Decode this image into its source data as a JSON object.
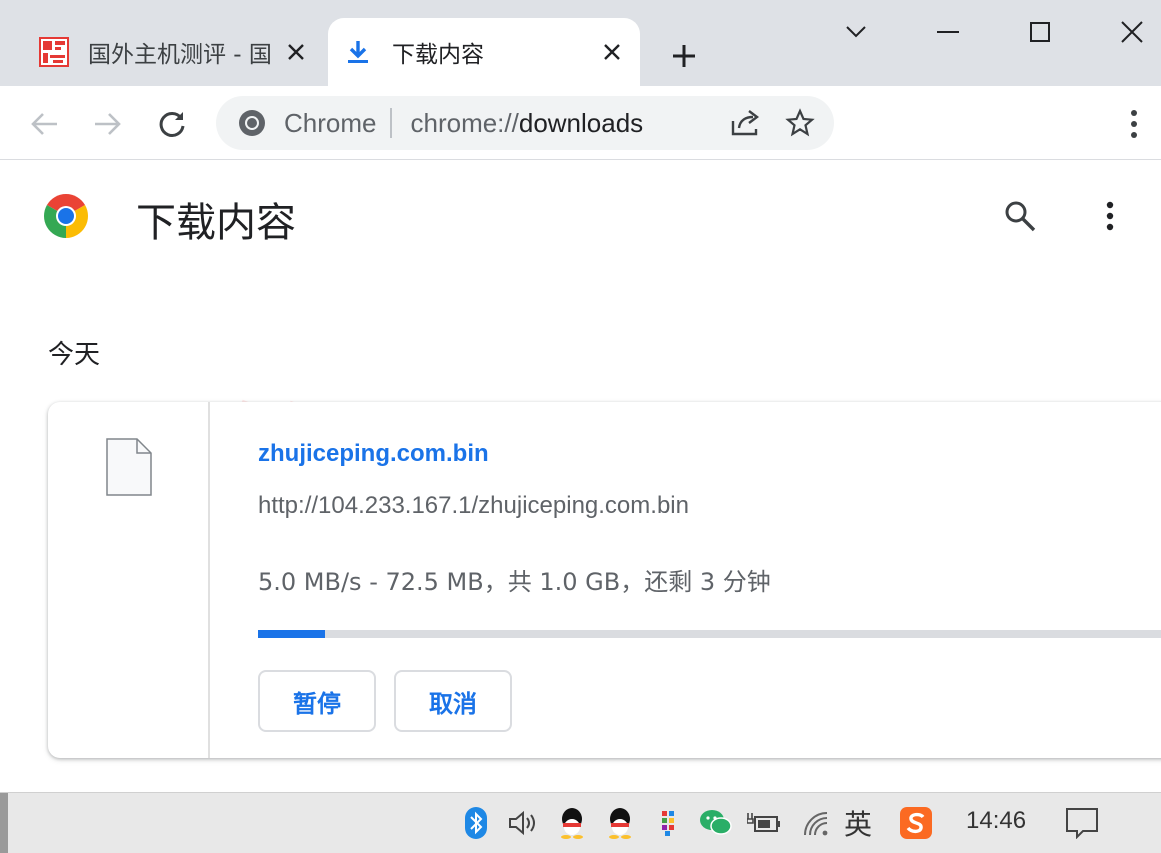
{
  "tabs": [
    {
      "title": "国外主机测评 - 国",
      "active": false,
      "favicon": "site-logo-icon"
    },
    {
      "title": "下载内容",
      "active": true,
      "favicon": "download-icon"
    }
  ],
  "omnibox": {
    "chip": "Chrome",
    "url_scheme": "chrome://",
    "url_rest": "downloads"
  },
  "page": {
    "title": "下载内容",
    "watermark": "zhujiceping.com",
    "section_date": "今天"
  },
  "download": {
    "file_name": "zhujiceping.com.bin",
    "url": "http://104.233.167.1/zhujiceping.com.bin",
    "status": "5.0 MB/s - 72.5 MB，共 1.0 GB，还剩 3 分钟",
    "progress_fraction": 0.0725,
    "pause_label": "暂停",
    "cancel_label": "取消"
  },
  "taskbar": {
    "ime": "英",
    "clock": "14:46"
  },
  "colors": {
    "accent": "#1a73e8",
    "tabstrip": "#dee1e6",
    "progress_track": "#dadce0"
  }
}
